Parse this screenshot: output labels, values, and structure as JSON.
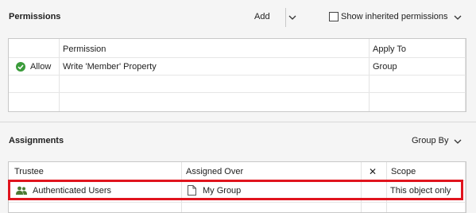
{
  "permissions": {
    "title": "Permissions",
    "add_label": "Add",
    "show_inherited_label": "Show inherited permissions",
    "show_inherited_checked": false,
    "columns": [
      "Permission",
      "Apply To"
    ],
    "rows": [
      {
        "type": "Allow",
        "permission": "Write 'Member' Property",
        "apply_to": "Group"
      }
    ]
  },
  "assignments": {
    "title": "Assignments",
    "group_by_label": "Group By",
    "columns": [
      "Trustee",
      "Assigned Over",
      "✕",
      "Scope"
    ],
    "rows": [
      {
        "trustee": "Authenticated Users",
        "assigned_over": "My Group",
        "scope": "This object only",
        "highlighted": true
      }
    ]
  },
  "colors": {
    "allow_green": "#3a9b3a",
    "highlight_red": "#e0141e",
    "users_icon": "#4c7a34"
  }
}
